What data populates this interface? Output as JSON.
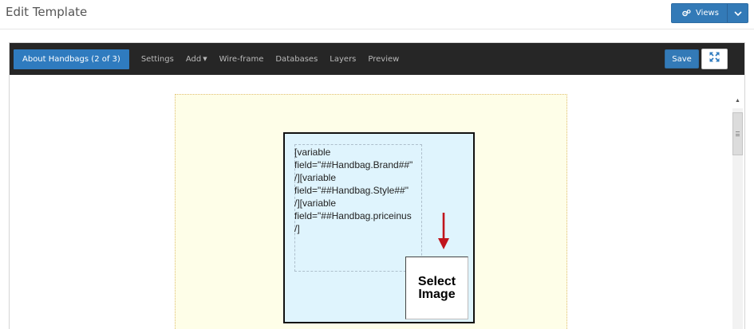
{
  "header": {
    "title": "Edit Template",
    "views_label": "Views",
    "views_icon": "gears-icon",
    "views_caret": "chevron-down-icon"
  },
  "toolbar": {
    "active_tab": "About Handbags (2 of 3)",
    "items": [
      {
        "label": "Settings",
        "has_dropdown": false
      },
      {
        "label": "Add",
        "has_dropdown": true
      },
      {
        "label": "Wire-frame",
        "has_dropdown": false
      },
      {
        "label": "Databases",
        "has_dropdown": false
      },
      {
        "label": "Layers",
        "has_dropdown": false
      },
      {
        "label": "Preview",
        "has_dropdown": false
      }
    ],
    "save_label": "Save",
    "expand_icon": "expand-arrows-icon"
  },
  "slide": {
    "text_content": "[variable\nfield=\"##Handbag.Brand##\"\n/][variable\nfield=\"##Handbag.Style##\"\n/][variable\nfield=\"##Handbag.priceinus\n/]",
    "image_placeholder": "Select\nImage",
    "arrow_icon": "red-down-arrow-icon"
  },
  "colors": {
    "primary": "#337ab7",
    "toolbar_bg": "#262626",
    "canvas_bg": "#fefee8",
    "slide_bg": "#dff4fd",
    "arrow": "#c0141c"
  }
}
